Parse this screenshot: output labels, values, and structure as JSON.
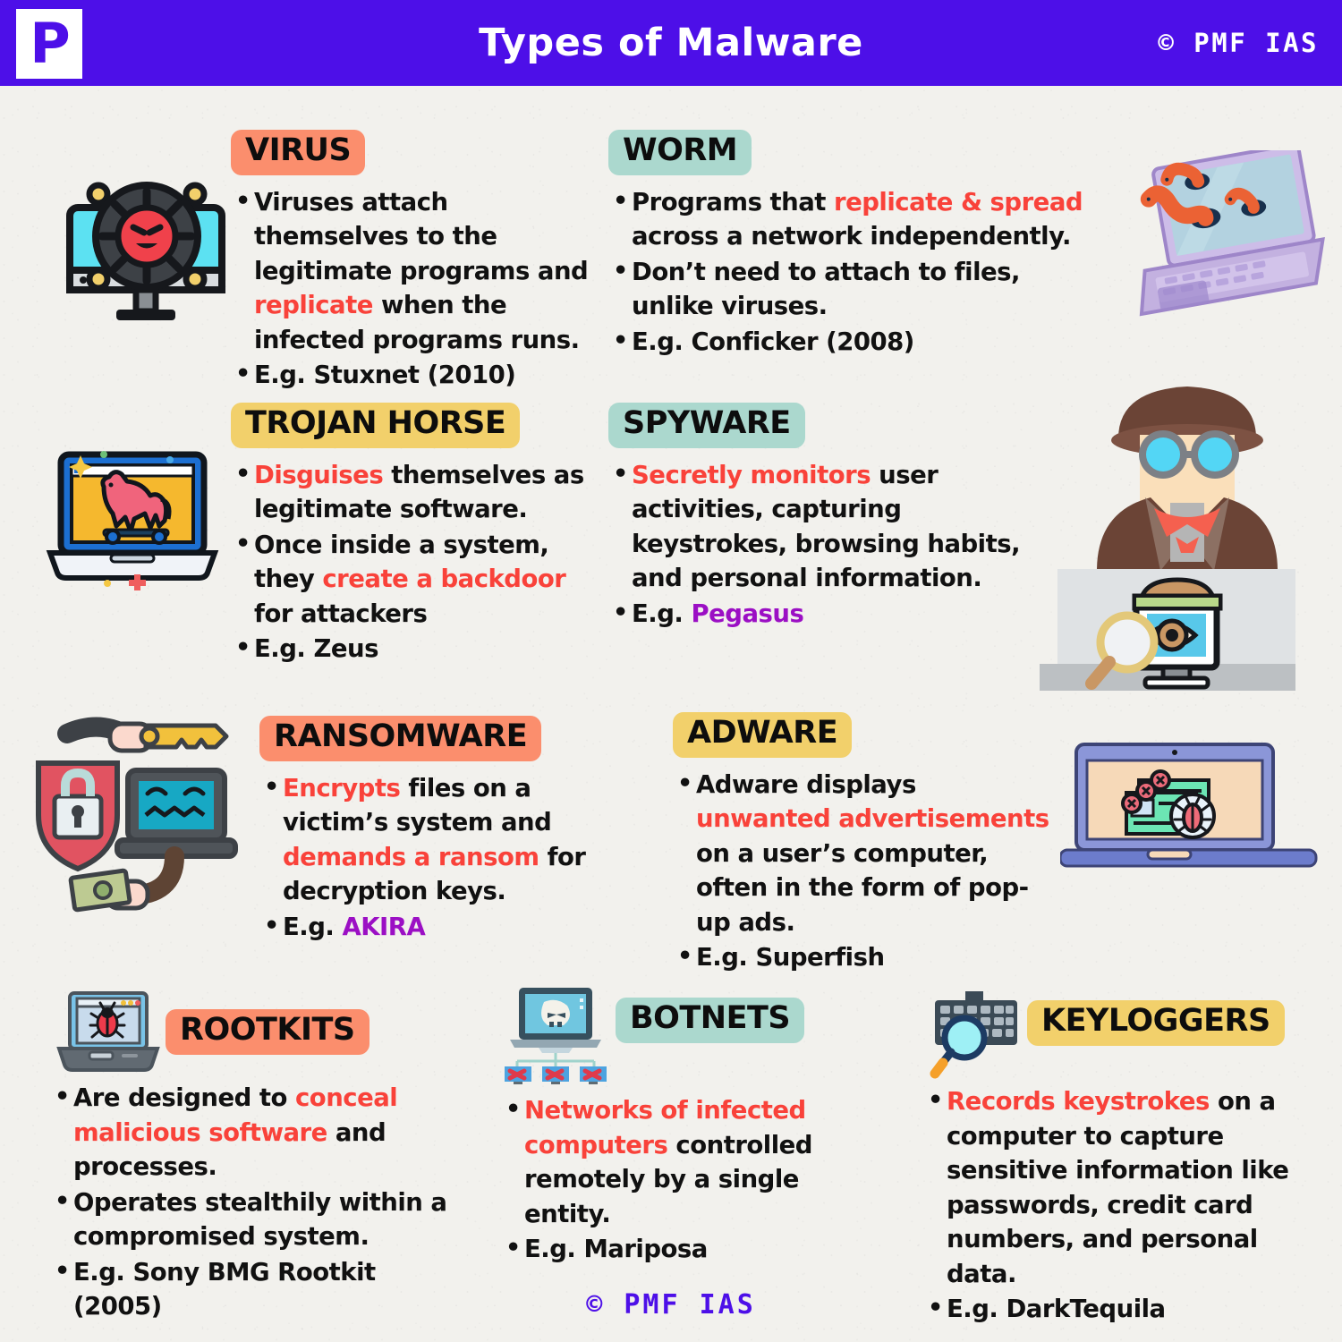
{
  "header": {
    "logo_letter": "P",
    "title": "Types of Malware",
    "credit": "© PMF IAS"
  },
  "footer": {
    "credit": "© PMF IAS"
  },
  "colors": {
    "header_purple": "#4d0fe8",
    "badge_salmon": "#fb8e6d",
    "badge_mint": "#abd8ce",
    "badge_gold": "#f2d06b",
    "highlight_red": "#f9423a",
    "highlight_purple": "#9b0fc4",
    "background": "#f2f1ed",
    "body_text": "#111111"
  },
  "sections": [
    {
      "id": "virus",
      "title": "VIRUS",
      "badge_color": "salmon",
      "icon": "monitor-virus-icon",
      "bullets": [
        [
          {
            "t": "Viruses attach themselves to the legitimate programs and ",
            "s": "plain"
          },
          {
            "t": "replicate",
            "s": "red"
          },
          {
            "t": " when the infected programs runs.",
            "s": "plain"
          }
        ],
        [
          {
            "t": "E.g. Stuxnet (2010)",
            "s": "plain"
          }
        ]
      ]
    },
    {
      "id": "worm",
      "title": "WORM",
      "badge_color": "mint",
      "icon": "laptop-worms-icon",
      "bullets": [
        [
          {
            "t": "Programs that ",
            "s": "plain"
          },
          {
            "t": "replicate & spread",
            "s": "red"
          },
          {
            "t": " across a network independently.",
            "s": "plain"
          }
        ],
        [
          {
            "t": "Don’t need to attach to files, unlike viruses.",
            "s": "plain"
          }
        ],
        [
          {
            "t": "E.g. Conficker (2008)",
            "s": "plain"
          }
        ]
      ]
    },
    {
      "id": "trojan-horse",
      "title": "TROJAN HORSE",
      "badge_color": "gold",
      "icon": "laptop-horse-icon",
      "bullets": [
        [
          {
            "t": "Disguises",
            "s": "red"
          },
          {
            "t": " themselves as legitimate software.",
            "s": "plain"
          }
        ],
        [
          {
            "t": "Once inside a system, they ",
            "s": "plain"
          },
          {
            "t": "create a backdoor",
            "s": "red"
          },
          {
            "t": " for attackers",
            "s": "plain"
          }
        ],
        [
          {
            "t": "E.g. Zeus",
            "s": "plain"
          }
        ]
      ]
    },
    {
      "id": "spyware",
      "title": "SPYWARE",
      "badge_color": "mint",
      "icon": "spy-detective-icon",
      "bullets": [
        [
          {
            "t": "Secretly monitors",
            "s": "red"
          },
          {
            "t": " user activities, capturing keystrokes, browsing habits, and personal information.",
            "s": "plain"
          }
        ],
        [
          {
            "t": "E.g. ",
            "s": "plain"
          },
          {
            "t": "Pegasus",
            "s": "purple"
          }
        ]
      ]
    },
    {
      "id": "ransomware",
      "title": "RANSOMWARE",
      "badge_color": "salmon",
      "icon": "shield-lock-key-money-icon",
      "bullets": [
        [
          {
            "t": "Encrypts",
            "s": "red"
          },
          {
            "t": " files on a victim’s system and ",
            "s": "plain"
          },
          {
            "t": "demands a ransom",
            "s": "red"
          },
          {
            "t": " for decryption keys.",
            "s": "plain"
          }
        ],
        [
          {
            "t": "E.g. ",
            "s": "plain"
          },
          {
            "t": "AKIRA",
            "s": "purple"
          }
        ]
      ]
    },
    {
      "id": "adware",
      "title": "ADWARE",
      "badge_color": "gold",
      "icon": "laptop-popups-bug-icon",
      "bullets": [
        [
          {
            "t": "Adware displays ",
            "s": "plain"
          },
          {
            "t": "unwanted advertisements",
            "s": "red"
          },
          {
            "t": " on a user’s computer, often in the form of pop-up ads.",
            "s": "plain"
          }
        ],
        [
          {
            "t": "E.g. Superfish",
            "s": "plain"
          }
        ]
      ]
    },
    {
      "id": "rootkits",
      "title": "ROOTKITS",
      "badge_color": "salmon",
      "icon": "laptop-bug-icon",
      "bullets": [
        [
          {
            "t": "Are designed to ",
            "s": "plain"
          },
          {
            "t": "conceal malicious software",
            "s": "red"
          },
          {
            "t": " and processes.",
            "s": "plain"
          }
        ],
        [
          {
            "t": "Operates stealthily within a compromised system.",
            "s": "plain"
          }
        ],
        [
          {
            "t": "E.g. Sony BMG Rootkit (2005)",
            "s": "plain"
          }
        ]
      ]
    },
    {
      "id": "botnets",
      "title": "BOTNETS",
      "badge_color": "mint",
      "icon": "laptop-skull-network-icon",
      "bullets": [
        [
          {
            "t": "Networks of infected computers",
            "s": "red"
          },
          {
            "t": " controlled remotely by a single entity.",
            "s": "plain"
          }
        ],
        [
          {
            "t": "E.g. Mariposa",
            "s": "plain"
          }
        ]
      ]
    },
    {
      "id": "keyloggers",
      "title": "KEYLOGGERS",
      "badge_color": "gold",
      "icon": "keyboard-magnifier-icon",
      "bullets": [
        [
          {
            "t": "Records keystrokes",
            "s": "red"
          },
          {
            "t": " on a computer to capture sensitive information like passwords, credit card numbers, and personal data.",
            "s": "plain"
          }
        ],
        [
          {
            "t": "E.g. DarkTequila",
            "s": "plain"
          }
        ]
      ]
    }
  ]
}
